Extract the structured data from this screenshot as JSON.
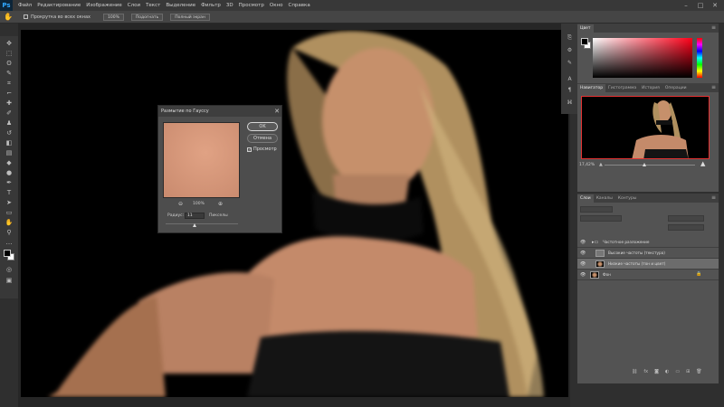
{
  "app": {
    "logo": "Ps"
  },
  "menu": [
    "Файл",
    "Редактирование",
    "Изображение",
    "Слои",
    "Текст",
    "Выделение",
    "Фильтр",
    "3D",
    "Просмотр",
    "Окно",
    "Справка"
  ],
  "options": {
    "scroll_all_label": "Прокрутка во всех окнах",
    "btn_100": "100%",
    "btn_fit": "Подогнать",
    "btn_full": "Полный экран"
  },
  "color_panel": {
    "tab": "Цвет",
    "hue_color": "#ff0019"
  },
  "nav_panel": {
    "tabs": [
      "Навигатор",
      "Гистограмма",
      "История",
      "Операции"
    ],
    "zoom": "17,42%"
  },
  "layers_panel": {
    "tabs": [
      "Слои",
      "Каналы",
      "Контуры"
    ],
    "layers": [
      {
        "name": "Частотное разложение",
        "group": true
      },
      {
        "name": "Высокие частоты (текстура)"
      },
      {
        "name": "Низкие частоты (тон и цвет)",
        "selected": true
      },
      {
        "name": "Фон",
        "locked": true
      }
    ]
  },
  "dialog": {
    "title": "Размытие по Гауссу",
    "ok": "OK",
    "cancel": "Отмена",
    "preview_label": "Просмотр",
    "zoom": "100%",
    "radius_label": "Радиус:",
    "radius_value": "11",
    "radius_unit": "Пикселы"
  }
}
